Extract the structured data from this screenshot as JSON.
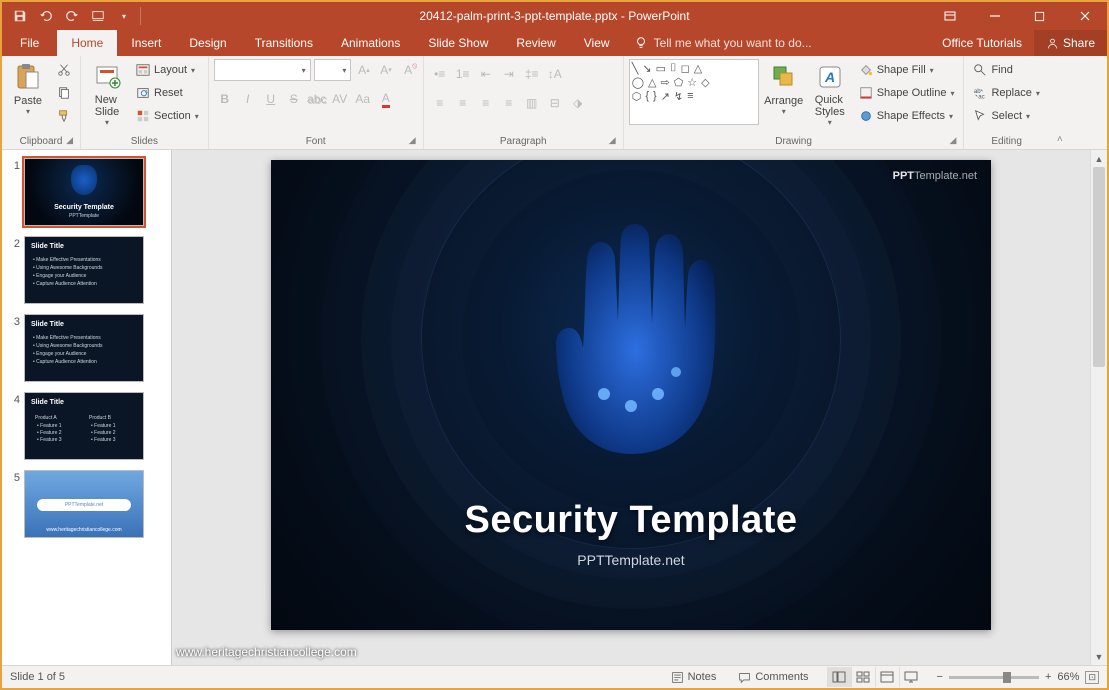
{
  "titlebar": {
    "filename": "20412-palm-print-3-ppt-template.pptx",
    "app": "PowerPoint"
  },
  "tabs": {
    "file": "File",
    "list": [
      "Home",
      "Insert",
      "Design",
      "Transitions",
      "Animations",
      "Slide Show",
      "Review",
      "View"
    ],
    "active": "Home",
    "tell_me": "Tell me what you want to do...",
    "office_tutorials": "Office Tutorials",
    "share": "Share"
  },
  "ribbon": {
    "clipboard": {
      "label": "Clipboard",
      "paste": "Paste",
      "cut": "Cut",
      "copy": "Copy",
      "format_painter": ""
    },
    "slides": {
      "label": "Slides",
      "new_slide": "New\nSlide",
      "layout": "Layout",
      "reset": "Reset",
      "section": "Section"
    },
    "font": {
      "label": "Font"
    },
    "paragraph": {
      "label": "Paragraph"
    },
    "drawing": {
      "label": "Drawing",
      "arrange": "Arrange",
      "quick_styles": "Quick\nStyles",
      "shape_fill": "Shape Fill",
      "shape_outline": "Shape Outline",
      "shape_effects": "Shape Effects"
    },
    "editing": {
      "label": "Editing",
      "find": "Find",
      "replace": "Replace",
      "select": "Select"
    }
  },
  "thumbs": [
    {
      "n": "1",
      "title": "Security Template",
      "sub": "PPTTemplate",
      "kind": "title"
    },
    {
      "n": "2",
      "title": "Slide Title",
      "bullets": [
        "Make Effective Presentations",
        "Using Awesome Backgrounds",
        "Engage your Audience",
        "Capture Audience Attention"
      ]
    },
    {
      "n": "3",
      "title": "Slide Title",
      "bullets": [
        "Make Effective Presentations",
        "Using Awesome Backgrounds",
        "Engage your Audience",
        "Capture Audience Attention"
      ]
    },
    {
      "n": "4",
      "title": "Slide Title",
      "cols": true
    },
    {
      "n": "5",
      "title": "",
      "kind": "end"
    }
  ],
  "slide": {
    "watermark_brand": "PPT",
    "watermark_suffix": "Template.net",
    "title": "Security Template",
    "subtitle": "PPTTemplate.net",
    "footer_link": "www.heritagechristiancollege.com"
  },
  "statusbar": {
    "slide_indicator": "Slide 1 of 5",
    "notes": "Notes",
    "comments": "Comments",
    "zoom": "66%"
  }
}
